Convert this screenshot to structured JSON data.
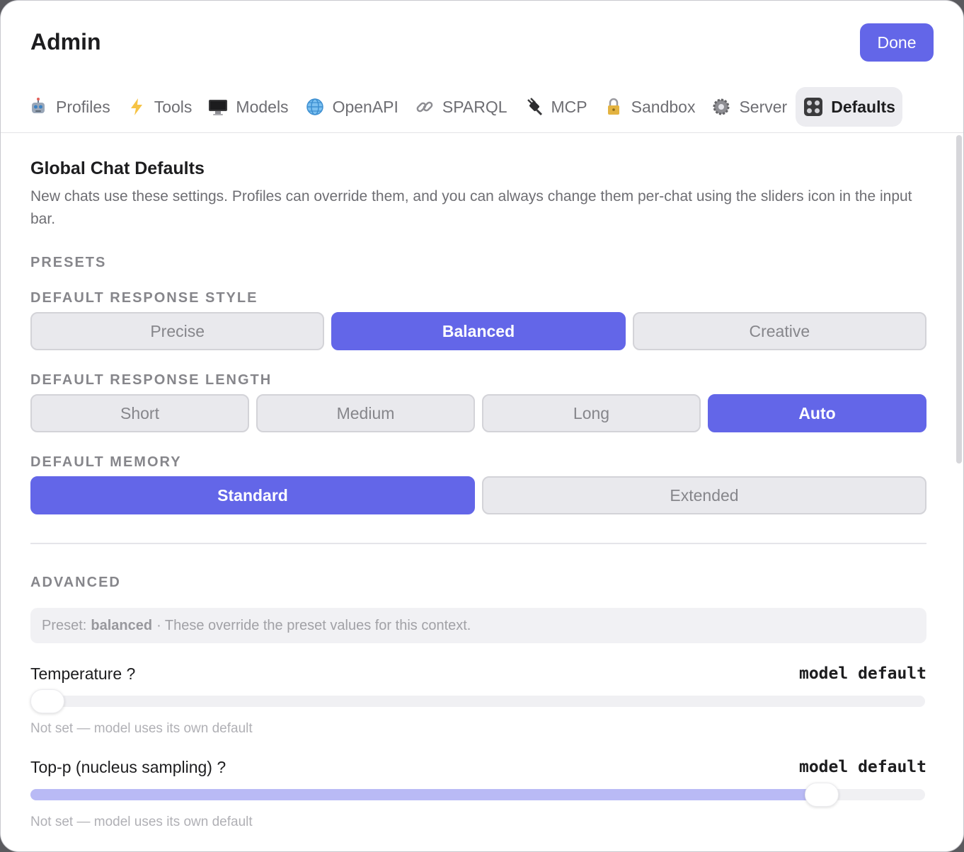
{
  "window": {
    "title": "Admin",
    "done_label": "Done"
  },
  "tabs": [
    {
      "label": "Profiles",
      "icon": "robot-icon"
    },
    {
      "label": "Tools",
      "icon": "lightning-icon"
    },
    {
      "label": "Models",
      "icon": "monitor-icon"
    },
    {
      "label": "OpenAPI",
      "icon": "globe-icon"
    },
    {
      "label": "SPARQL",
      "icon": "link-icon"
    },
    {
      "label": "MCP",
      "icon": "plug-icon"
    },
    {
      "label": "Sandbox",
      "icon": "lock-icon"
    },
    {
      "label": "Server",
      "icon": "gear-icon"
    },
    {
      "label": "Defaults",
      "icon": "control-knobs-icon",
      "active": true
    }
  ],
  "defaults": {
    "title": "Global Chat Defaults",
    "description": "New chats use these settings. Profiles can override them, and you can always change them per-chat using the sliders icon in the input bar.",
    "presets_heading": "PRESETS",
    "response_style": {
      "label": "DEFAULT RESPONSE STYLE",
      "options": [
        "Precise",
        "Balanced",
        "Creative"
      ],
      "selected": "Balanced"
    },
    "response_length": {
      "label": "DEFAULT RESPONSE LENGTH",
      "options": [
        "Short",
        "Medium",
        "Long",
        "Auto"
      ],
      "selected": "Auto"
    },
    "memory": {
      "label": "DEFAULT MEMORY",
      "options": [
        "Standard",
        "Extended"
      ],
      "selected": "Standard"
    },
    "advanced_heading": "ADVANCED",
    "preset_note": {
      "prefix": "Preset:",
      "preset_name": "balanced",
      "suffix": "· These override the preset values for this context."
    },
    "params": [
      {
        "label": "Temperature ?",
        "value": "model default",
        "hint": "Not set — model uses its own default",
        "level": 0.0
      },
      {
        "label": "Top-p (nucleus sampling) ?",
        "value": "model default",
        "hint": "Not set — model uses its own default",
        "level": 0.9
      }
    ]
  },
  "colors": {
    "accent": "#6366e8",
    "slider_fill": "#b9baf5"
  }
}
